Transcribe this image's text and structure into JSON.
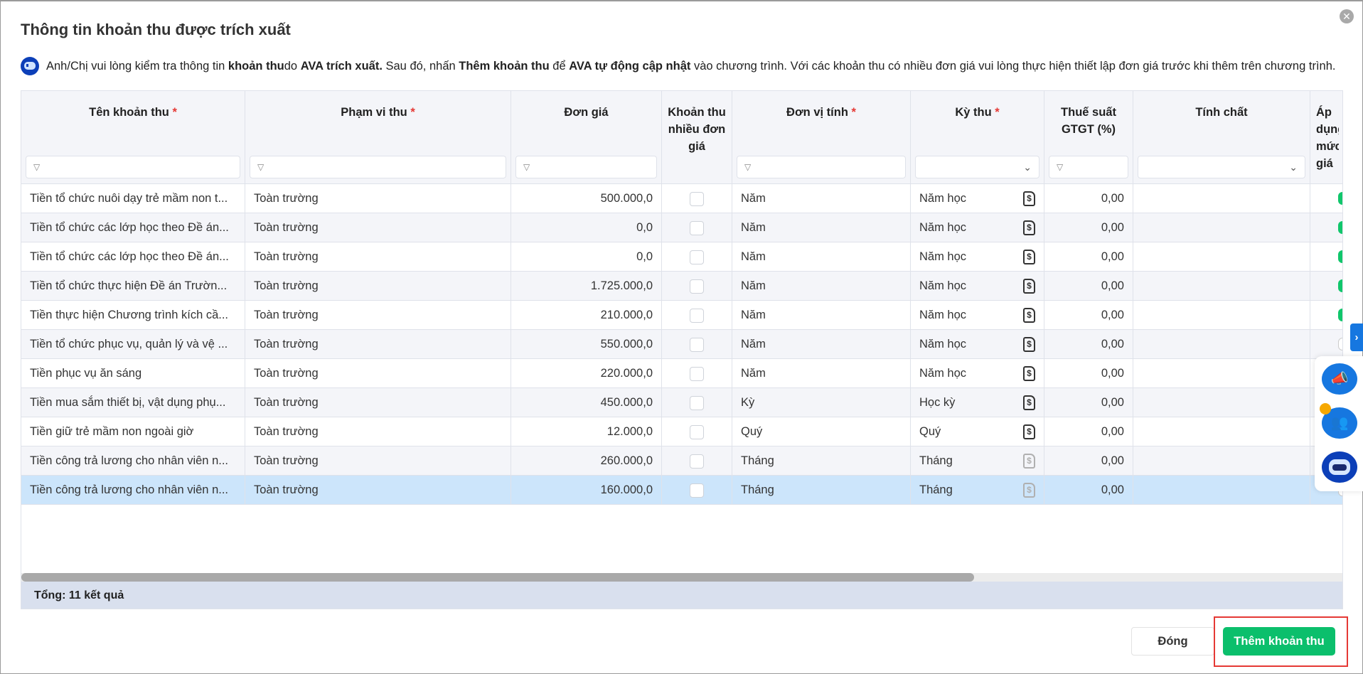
{
  "dialog": {
    "title": "Thông tin khoản thu được trích xuất",
    "info": {
      "p1": "Anh/Chị vui lòng kiểm tra thông tin ",
      "b1": "khoản thu",
      "p2": " do ",
      "b2": "AVA trích xuất.",
      "p3": " Sau đó, nhấn ",
      "b3": "Thêm khoản thu",
      "p4": " để ",
      "b4": "AVA tự động cập nhật",
      "p5": " vào chương trình. Với các khoản thu có nhiều đơn giá vui lòng thực hiện thiết lập đơn giá trước khi thêm trên chương trình."
    },
    "columns": [
      {
        "label": "Tên khoản thu",
        "required": "*"
      },
      {
        "label": "Phạm vi thu",
        "required": "*"
      },
      {
        "label": "Đơn giá"
      },
      {
        "label": "Khoản thu nhiều đơn giá"
      },
      {
        "label": "Đơn vị tính",
        "required": "*"
      },
      {
        "label": "Kỳ thu",
        "required": "*"
      },
      {
        "label": "Thuế suất GTGT (%)"
      },
      {
        "label": "Tính chất"
      },
      {
        "label": "Áp dụng mức giá"
      }
    ],
    "rows": [
      {
        "name": "Tiền tổ chức nuôi dạy trẻ mầm non t...",
        "scope": "Toàn trường",
        "price": "500.000,0",
        "multi": false,
        "unit": "Năm",
        "period": "Năm học",
        "period_icon_active": true,
        "vat": "0,00",
        "nature": "",
        "apply": true
      },
      {
        "name": "Tiền tổ chức các lớp học theo Đề án...",
        "scope": "Toàn trường",
        "price": "0,0",
        "multi": false,
        "unit": "Năm",
        "period": "Năm học",
        "period_icon_active": true,
        "vat": "0,00",
        "nature": "",
        "apply": true
      },
      {
        "name": "Tiền tổ chức các lớp học theo Đề án...",
        "scope": "Toàn trường",
        "price": "0,0",
        "multi": false,
        "unit": "Năm",
        "period": "Năm học",
        "period_icon_active": true,
        "vat": "0,00",
        "nature": "",
        "apply": true
      },
      {
        "name": "Tiền tổ chức thực hiện Đề án Trườn...",
        "scope": "Toàn trường",
        "price": "1.725.000,0",
        "multi": false,
        "unit": "Năm",
        "period": "Năm học",
        "period_icon_active": true,
        "vat": "0,00",
        "nature": "",
        "apply": true
      },
      {
        "name": "Tiền thực hiện Chương trình kích cầ...",
        "scope": "Toàn trường",
        "price": "210.000,0",
        "multi": false,
        "unit": "Năm",
        "period": "Năm học",
        "period_icon_active": true,
        "vat": "0,00",
        "nature": "",
        "apply": true
      },
      {
        "name": "Tiền tổ chức phục vụ, quản lý và vệ ...",
        "scope": "Toàn trường",
        "price": "550.000,0",
        "multi": false,
        "unit": "Năm",
        "period": "Năm học",
        "period_icon_active": true,
        "vat": "0,00",
        "nature": "",
        "apply": false
      },
      {
        "name": "Tiền phục vụ ăn sáng",
        "scope": "Toàn trường",
        "price": "220.000,0",
        "multi": false,
        "unit": "Năm",
        "period": "Năm học",
        "period_icon_active": true,
        "vat": "0,00",
        "nature": "",
        "apply": false
      },
      {
        "name": "Tiền mua sắm thiết bị, vật dụng phụ...",
        "scope": "Toàn trường",
        "price": "450.000,0",
        "multi": false,
        "unit": "Kỳ",
        "period": "Học kỳ",
        "period_icon_active": true,
        "vat": "0,00",
        "nature": "",
        "apply": false
      },
      {
        "name": "Tiền giữ trẻ mầm non ngoài giờ",
        "scope": "Toàn trường",
        "price": "12.000,0",
        "multi": false,
        "unit": "Quý",
        "period": "Quý",
        "period_icon_active": true,
        "vat": "0,00",
        "nature": "",
        "apply": false
      },
      {
        "name": "Tiền công trả lương cho nhân viên n...",
        "scope": "Toàn trường",
        "price": "260.000,0",
        "multi": false,
        "unit": "Tháng",
        "period": "Tháng",
        "period_icon_active": false,
        "vat": "0,00",
        "nature": "",
        "apply": false
      },
      {
        "name": "Tiền công trả lương cho nhân viên n...",
        "scope": "Toàn trường",
        "price": "160.000,0",
        "multi": false,
        "unit": "Tháng",
        "period": "Tháng",
        "period_icon_active": false,
        "vat": "0,00",
        "nature": "",
        "apply": false,
        "selected": true
      }
    ],
    "footer_total": "Tổng: 11 kết quả",
    "close_label": "Đóng",
    "add_label": "Thêm khoản thu",
    "icons": {
      "close": "close-circle-icon",
      "filter": "filter-icon",
      "dropdown": "chevron-down-icon",
      "period": "dollar-document-icon",
      "side_tab": "chevron-right-icon",
      "fab1": "megaphone-icon",
      "fab2": "group-icon",
      "fab3": "ava-bot-icon"
    },
    "colors": {
      "primary_green": "#0bbf6c",
      "highlight": "#e53935",
      "selected_row": "#cce5fb",
      "blue": "#1677e0"
    }
  }
}
